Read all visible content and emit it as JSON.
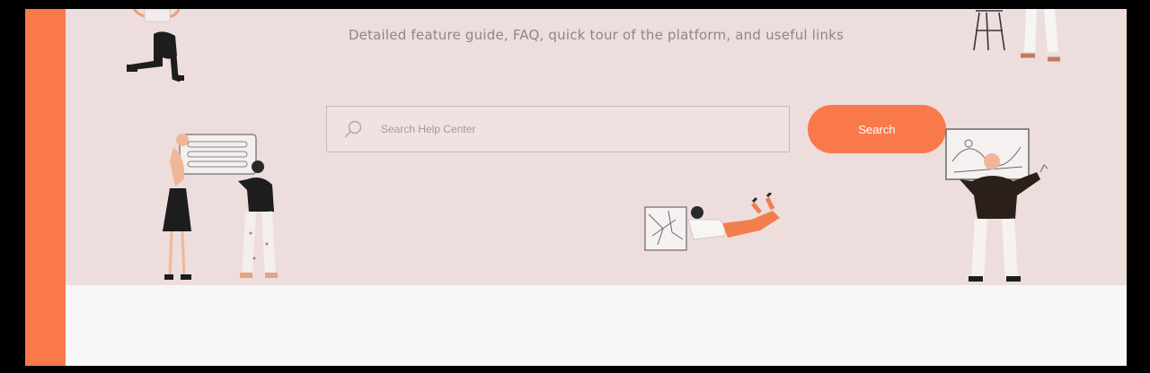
{
  "hero": {
    "subtitle": "Detailed feature guide, FAQ, quick tour of the platform, and useful links"
  },
  "search": {
    "placeholder": "Search Help Center",
    "button_label": "Search"
  },
  "colors": {
    "accent": "#f9794b",
    "hero_background": "#eddddd",
    "page_background": "#f8f7f8"
  },
  "illustrations": [
    "person-kneeling-illustration",
    "people-holding-form-illustration",
    "person-lying-reading-illustration",
    "person-at-whiteboard-illustration",
    "person-at-stool-illustration"
  ]
}
